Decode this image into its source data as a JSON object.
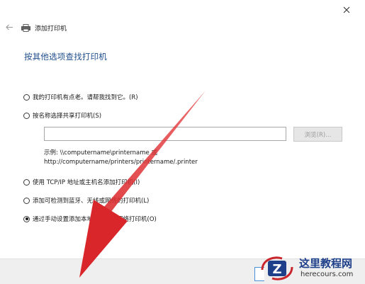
{
  "dialog": {
    "title": "添加打印机",
    "heading": "按其他选项查找打印机"
  },
  "options": [
    {
      "label": "我的打印机有点老。请帮我找到它。(R)",
      "checked": false
    },
    {
      "label": "按名称选择共享打印机(S)",
      "checked": false
    },
    {
      "label": "使用 TCP/IP 地址或主机名添加打印机(I)",
      "checked": false
    },
    {
      "label": "添加可检测到蓝牙、无线或网络的打印机(L)",
      "checked": false
    },
    {
      "label": "通过手动设置添加本地打印机或网络打印机(O)",
      "checked": true
    }
  ],
  "share": {
    "input_value": "",
    "browse_label": "浏览(R)...",
    "example_line1": "示例: \\\\computername\\printername 或",
    "example_line2": "http://computername/printers/printername/.printer"
  },
  "annotation": {
    "arrow_color": "#e0282c"
  },
  "watermark": {
    "title": "这里教程网",
    "url": "herecours.com",
    "logo_letter": "Z"
  },
  "icons": {
    "close": "close-icon",
    "back": "back-arrow-icon",
    "printer": "printer-icon"
  }
}
